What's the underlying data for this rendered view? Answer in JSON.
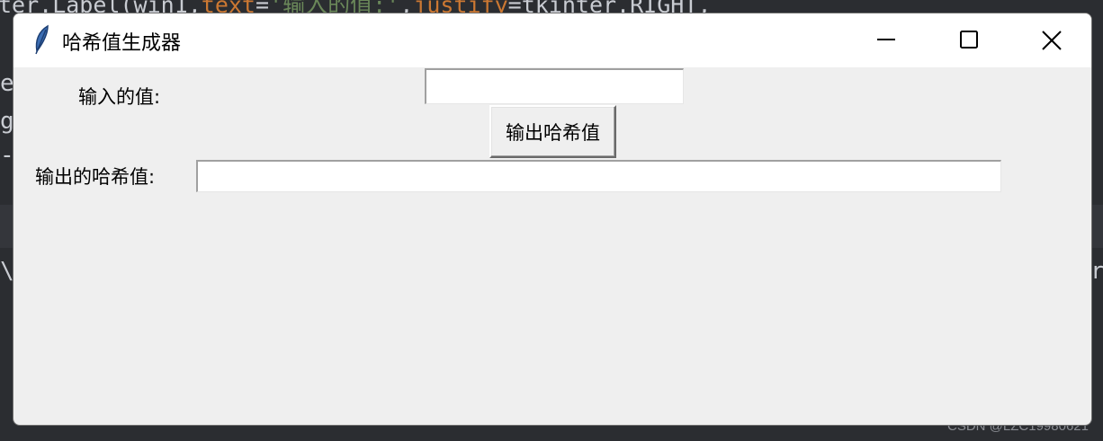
{
  "editor": {
    "line1_segments": {
      "prefix": "ter.Label(win1,",
      "kw1": "text",
      "eq1": "=",
      "str1": "'输入的值:'",
      "comma": ",",
      "kw2": "justify",
      "eq2": "=",
      "suffix": "tkinter.RIGHT,"
    },
    "edge_chars": [
      "e",
      "g",
      "-",
      "\\",
      "r"
    ]
  },
  "watermark": "CSDN @LZC19980621",
  "window": {
    "title": "哈希值生成器",
    "icon": "feather-icon",
    "controls": [
      "minimize-icon",
      "maximize-icon",
      "close-icon"
    ]
  },
  "form": {
    "input_label": "输入的值:",
    "input_value": "",
    "button_label": "输出哈希值",
    "output_label": "输出的哈希值:",
    "output_value": ""
  }
}
